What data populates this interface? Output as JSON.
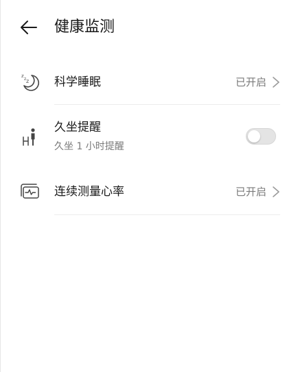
{
  "header": {
    "title": "健康监测",
    "back_icon": "back-arrow-icon"
  },
  "items": [
    {
      "icon": "sleep-moon-icon",
      "label": "科学睡眠",
      "status": "已开启",
      "has_chevron": true
    },
    {
      "icon": "sedentary-person-icon",
      "label": "久坐提醒",
      "sublabel": "久坐 1 小时提醒",
      "toggle_on": false
    },
    {
      "icon": "heart-rate-monitor-icon",
      "label": "连续测量心率",
      "status": "已开启",
      "has_chevron": true
    }
  ],
  "colors": {
    "text_primary": "#1a1a1a",
    "text_secondary": "#7a7a7a",
    "divider": "#ececec",
    "toggle_off": "#e4e4e4"
  }
}
